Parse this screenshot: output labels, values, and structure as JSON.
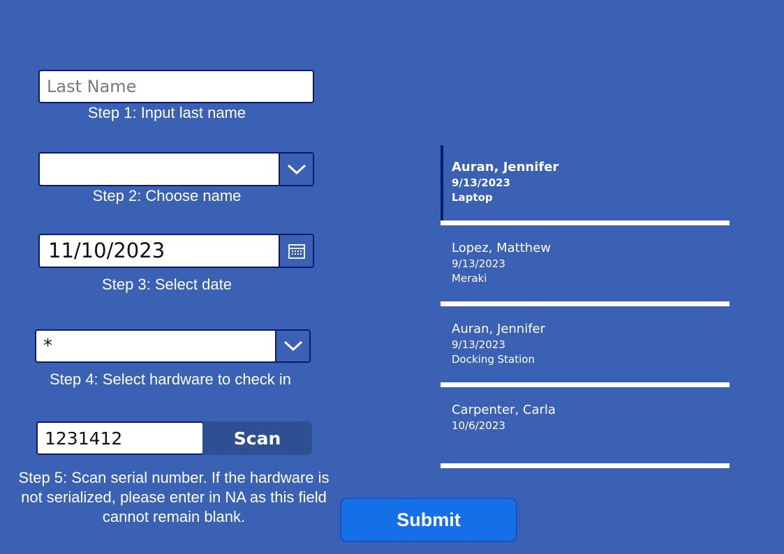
{
  "form": {
    "last_name": {
      "value": "",
      "placeholder": "Last Name",
      "step_label": "Step 1:  Input last name"
    },
    "choose_name": {
      "value": "",
      "step_label": "Step 2:  Choose name"
    },
    "date": {
      "value": "11/10/2023",
      "step_label": "Step 3:  Select date"
    },
    "hardware": {
      "value": "*",
      "step_label": "Step 4:  Select hardware to check in"
    },
    "serial": {
      "value": "1231412",
      "scan_label": "Scan",
      "step_label": "Step 5:  Scan serial number.  If the hardware is not serialized, please enter in NA as this field cannot remain blank."
    },
    "submit_label": "Submit"
  },
  "gallery": [
    {
      "name": "Auran, Jennifer",
      "date": "9/13/2023",
      "hardware": "Laptop",
      "selected": true
    },
    {
      "name": "Lopez, Matthew",
      "date": "9/13/2023",
      "hardware": "Meraki",
      "selected": false
    },
    {
      "name": "Auran, Jennifer",
      "date": "9/13/2023",
      "hardware": "Docking Station",
      "selected": false
    },
    {
      "name": "Carpenter, Carla",
      "date": "10/6/2023",
      "hardware": "",
      "selected": false
    }
  ],
  "icons": {
    "dropdown": "chevron-down-icon",
    "date": "calendar-icon"
  },
  "colors": {
    "background": "#3a61b3",
    "field_border": "#0b1a6b",
    "submit": "#1570e8",
    "scan": "#2f4f93"
  }
}
